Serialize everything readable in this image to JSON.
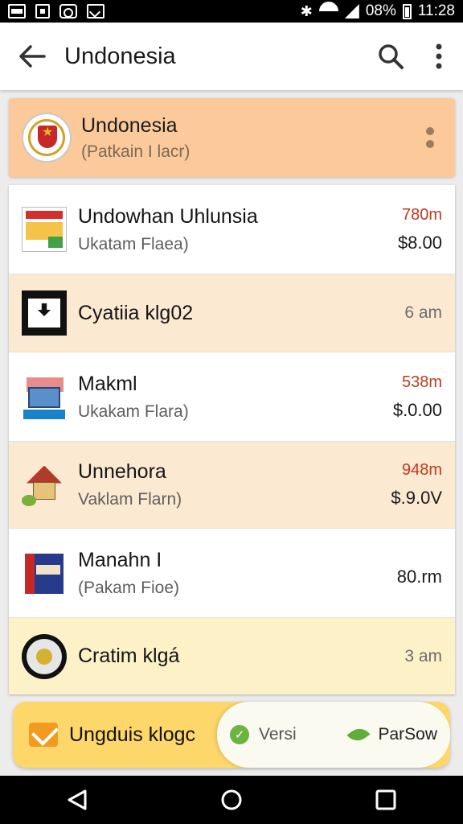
{
  "status_bar": {
    "battery": "08%",
    "time": "11:28"
  },
  "app_bar": {
    "title": "Undonesia",
    "icons": {
      "back": "back-arrow-icon",
      "search": "search-icon",
      "more": "more-vert-icon"
    }
  },
  "header_card": {
    "title": "Undonesia",
    "subtitle": "(Patkain I lacr)"
  },
  "items": [
    {
      "title": "Undowhan Uhlunsia",
      "subtitle": "Ukatam Flaea)",
      "distance": "780m",
      "price": "$8.00"
    },
    {
      "title": "Cyatiia klg02",
      "time": "6 am"
    },
    {
      "title": "Makml",
      "subtitle": "Ukakam Flara)",
      "distance": "538m",
      "price": "$.0.00"
    },
    {
      "title": "Unnehora",
      "subtitle": "Vaklam Flarn)",
      "distance": "948m",
      "price": "$.9.0V"
    },
    {
      "title": "Manahn I",
      "subtitle": "(Pakam Fioe)",
      "distance": "",
      "price": "80.rm"
    },
    {
      "title": "Cratim klgá",
      "time": "3 am"
    }
  ],
  "bottom_bar": {
    "label": "Ungduis klogc",
    "pill_left": "Versi",
    "pill_right": "ParSow"
  },
  "colors": {
    "header_card": "#fbc99a",
    "row_peach": "#fce9d2",
    "row_cream": "#fcf1c7",
    "distance_red": "#c0391f",
    "bottom_bar": "#fdd76a"
  }
}
